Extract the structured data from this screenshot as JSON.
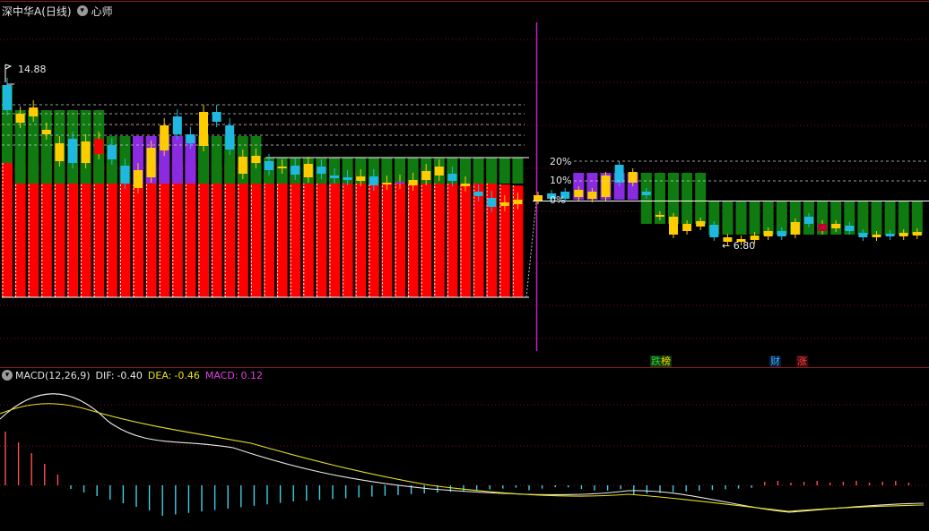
{
  "header": {
    "title": "深中华A(日线)",
    "indicator": "心师",
    "menu_glyph": "▾"
  },
  "price_labels": {
    "high": "14.88",
    "low": "6.80"
  },
  "percent_labels": [
    "20%",
    "10%",
    "0%"
  ],
  "badges": [
    {
      "text1": "跌",
      "text2": "榜",
      "color1": "#2ecc40",
      "color2": "#ffd700"
    },
    {
      "text": "财",
      "color": "#39b6ff"
    },
    {
      "text": "涨",
      "color": "#ff4040"
    }
  ],
  "macd_header": {
    "name": "MACD(12,26,9)",
    "dif_label": "DIF:",
    "dif_value": "-0.40",
    "dea_label": "DEA:",
    "dea_value": "-0.46",
    "macd_label": "MACD:",
    "macd_value": "0.12"
  },
  "colors": {
    "red": "#ff0000",
    "green": "#0f7a0f",
    "purple": "#8a2be2",
    "gold": "#ffcc00",
    "cyan": "#1fb8e0",
    "grid": "#7a1010",
    "magenta": "#c020c0",
    "dif": "#e8e8e8",
    "dea": "#e8e020"
  }
}
